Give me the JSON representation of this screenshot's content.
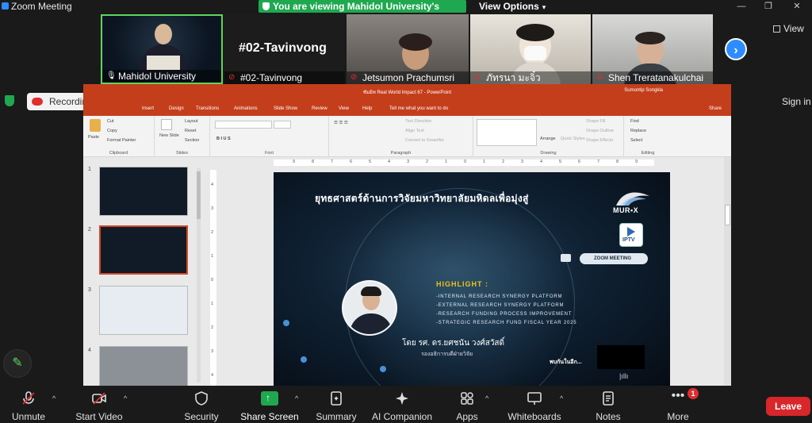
{
  "window": {
    "title": "Zoom Meeting",
    "share_banner": "You are viewing Mahidol University's screen",
    "view_options": "View Options",
    "view_label": "View",
    "sign_in": "Sign in",
    "recording_label": "Recording..."
  },
  "participants": [
    {
      "name": "Mahidol University",
      "muted": false
    },
    {
      "name": "#02-Tavinvong",
      "display_name": "#02-Tavinvong",
      "muted": true
    },
    {
      "name": "Jetsumon Prachumsri",
      "muted": true
    },
    {
      "name": "ภัทรนา มะจิ๋ว",
      "muted": true
    },
    {
      "name": "Shen Treratanakulchai",
      "muted": true
    }
  ],
  "ppt": {
    "title": "ซัมมิท Real World Impact 67  -  PowerPoint",
    "user": "Sumontip Songkla",
    "tabs": [
      "Insert",
      "Design",
      "Transitions",
      "Animations",
      "Slide Show",
      "Review",
      "View",
      "Help",
      "Tell me what you want to do"
    ],
    "share": "Share",
    "ribbon": {
      "clipboard": {
        "label": "Clipboard",
        "paste": "Paste",
        "cut": "Cut",
        "copy": "Copy",
        "format_painter": "Format Painter"
      },
      "slides": {
        "label": "Slides",
        "new_slide": "New Slide",
        "layout": "Layout",
        "reset": "Reset",
        "section": "Section"
      },
      "font": {
        "label": "Font"
      },
      "paragraph": {
        "label": "Paragraph",
        "text_direction": "Text Direction",
        "align_text": "Align Text",
        "smartart": "Convert to SmartArt"
      },
      "drawing": {
        "label": "Drawing",
        "arrange": "Arrange",
        "quick_styles": "Quick Styles",
        "shape_fill": "Shape Fill",
        "shape_outline": "Shape Outline",
        "shape_effects": "Shape Effects"
      },
      "editing": {
        "label": "Editing",
        "find": "Find",
        "replace": "Replace",
        "select": "Select"
      }
    },
    "slide_numbers": [
      "1",
      "2",
      "3",
      "4"
    ],
    "ruler_top": [
      "9",
      "8",
      "7",
      "6",
      "5",
      "4",
      "3",
      "2",
      "1",
      "0",
      "1",
      "2",
      "3",
      "4",
      "5",
      "6",
      "7",
      "8",
      "9"
    ],
    "ruler_left": [
      "4",
      "3",
      "2",
      "1",
      "0",
      "1",
      "2",
      "3",
      "4"
    ]
  },
  "slide": {
    "title": "ยุทธศาสตร์ด้านการวิจัยมหาวิทยาลัยมหิดลเพื่อมุ่งสู่",
    "logo_text": "MUR•X",
    "iptv": "IPTV",
    "zoom_meeting": "ZOOM MEETING",
    "highlight": "HIGHLIGHT :",
    "items": [
      "-INTERNAL RESEARCH SYNERGY PLATFORM",
      "-EXTERNAL RESEARCH SYNERGY PLATFORM",
      "-RESEARCH FUNDING PROCESS IMPROVEMENT",
      "-STRATEGIC RESEARCH FUND FISCAL YEAR 2025"
    ],
    "speaker_name": "โดย รศ. ดร.ยศชนัน วงศ์สวัสดิ์",
    "speaker_role": "รองอธิการบดีฝ่ายวิจัย",
    "see_you": "พบกันในอีก..."
  },
  "toolbar": {
    "unmute": "Unmute",
    "start_video": "Start Video",
    "security": "Security",
    "share_screen": "Share Screen",
    "summary": "Summary",
    "ai_companion": "AI Companion",
    "apps": "Apps",
    "whiteboards": "Whiteboards",
    "notes": "Notes",
    "more": "More",
    "more_badge": "1",
    "leave": "Leave"
  },
  "colors": {
    "zoom_blue": "#2d8cff",
    "share_green": "#1fa84f",
    "leave_red": "#d8262b",
    "ppt_orange": "#c43e1c",
    "highlight_gold": "#f0c419"
  }
}
